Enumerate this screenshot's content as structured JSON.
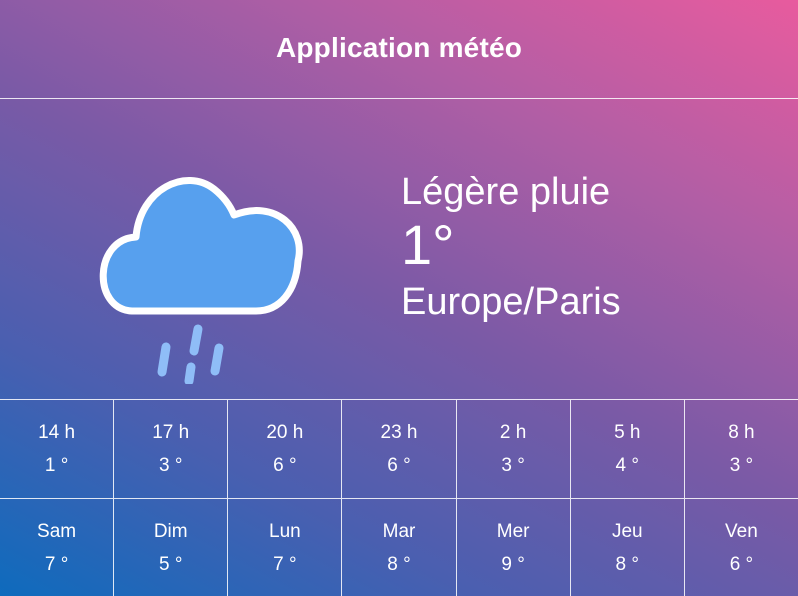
{
  "header": {
    "title": "Application météo"
  },
  "current": {
    "condition": "Légère pluie",
    "temperature": "1°",
    "location": "Europe/Paris",
    "icon": "rain-cloud-icon"
  },
  "hourly": [
    {
      "time": "14 h",
      "temp": "1 °"
    },
    {
      "time": "17 h",
      "temp": "3 °"
    },
    {
      "time": "20 h",
      "temp": "6 °"
    },
    {
      "time": "23 h",
      "temp": "6 °"
    },
    {
      "time": "2 h",
      "temp": "3 °"
    },
    {
      "time": "5 h",
      "temp": "4 °"
    },
    {
      "time": "8 h",
      "temp": "3 °"
    }
  ],
  "daily": [
    {
      "day": "Sam",
      "temp": "7 °"
    },
    {
      "day": "Dim",
      "temp": "5 °"
    },
    {
      "day": "Lun",
      "temp": "7 °"
    },
    {
      "day": "Mar",
      "temp": "8 °"
    },
    {
      "day": "Mer",
      "temp": "9 °"
    },
    {
      "day": "Jeu",
      "temp": "8 °"
    },
    {
      "day": "Ven",
      "temp": "6 °"
    }
  ],
  "colors": {
    "cloud_fill": "#57a0ee",
    "cloud_stroke": "#ffffff",
    "rain": "#8fbdf7"
  }
}
